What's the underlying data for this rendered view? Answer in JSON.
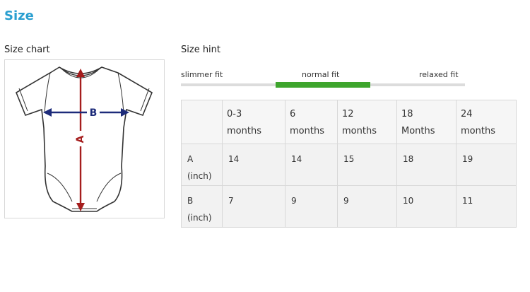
{
  "page": {
    "title": "Size",
    "size_chart_label": "Size chart",
    "size_hint_label": "Size hint"
  },
  "diagram": {
    "label_a": "A",
    "label_b": "B"
  },
  "hint": {
    "slimmer": "slimmer fit",
    "normal": "normal fit",
    "relaxed": "relaxed fit",
    "active": "normal fit",
    "active_color": "#3ea52d"
  },
  "table": {
    "columns": [
      {
        "line1": "0-3",
        "line2": "months"
      },
      {
        "line1": "6",
        "line2": "months"
      },
      {
        "line1": "12",
        "line2": "months"
      },
      {
        "line1": "18",
        "line2": "Months"
      },
      {
        "line1": "24",
        "line2": "months"
      }
    ],
    "rows": [
      {
        "label1": "A",
        "label2": "(inch)",
        "values": [
          "14",
          "14",
          "15",
          "18",
          "19"
        ]
      },
      {
        "label1": "B",
        "label2": "(inch)",
        "values": [
          "7",
          "9",
          "9",
          "10",
          "11"
        ]
      }
    ]
  },
  "colors": {
    "title": "#2a9fd0",
    "arrow_a": "#a51d1d",
    "arrow_b": "#1d2b7a"
  }
}
